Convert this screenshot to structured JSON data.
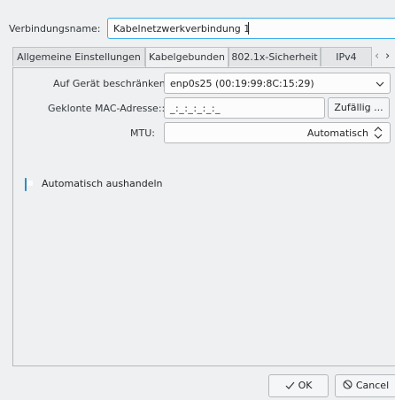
{
  "connection": {
    "name_label": "Verbindungsname:",
    "name_value": "Kabelnetzwerkverbindung 1"
  },
  "tabs": [
    {
      "label": "Allgemeine Einstellungen"
    },
    {
      "label": "Kabelgebunden"
    },
    {
      "label": "802.1x-Sicherheit"
    },
    {
      "label": "IPv4"
    }
  ],
  "tab_scroll": {
    "left": "‹",
    "right": "›"
  },
  "wired": {
    "device_label": "Auf Gerät beschränken:",
    "device_value": "enp0s25 (00:19:99:8C:15:29)",
    "mac_label": "Geklonte MAC-Adresse::",
    "mac_value": "_:_:_:_:_:_",
    "random_button": "Zufällig ...",
    "mtu_label": "MTU:",
    "mtu_value": "Automatisch",
    "auto_negotiate_label": "Automatisch aushandeln",
    "auto_negotiate_checked": true
  },
  "footer": {
    "ok_label": "OK",
    "cancel_label": "Cancel"
  },
  "colors": {
    "accent": "#3daee9",
    "background": "#eff0f1"
  }
}
